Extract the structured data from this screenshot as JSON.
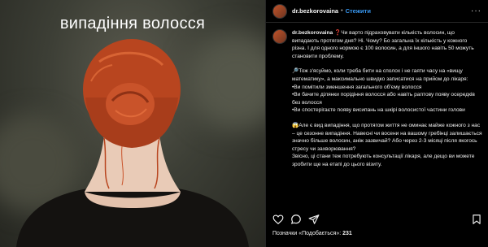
{
  "photo": {
    "caption": "випадіння волосся"
  },
  "header": {
    "username": "dr.bezkorovaina",
    "separator": "•",
    "follow_label": "Стежити",
    "more": "···"
  },
  "post": {
    "username": "dr.bezkorovaina",
    "paragraphs": [
      "❓Чи варто підраховувати кількість волосин, що випадають протягом дня? Ні. Чому? Бо загальна їх кількість у кожного різна. І для одного нормою є 100 волосин, а для іншого навіть 50 можуть становити проблему.",
      "🔎Тож з'ясуймо, коли треба бити на сполох і не гаяти часу на «вищу математику», а максимально швидко записатися на прийом до лікаря:\n•Ви помітили зменшення загального об'єму волосся\n•Ви бачите ділянки порідіння волосся або навіть раптову появу осередків без волосся\n•Ви спостерігаєте появу висипань на шкірі волосистої частини голови",
      "😱Але є вид випадіння, що протягом життя не оминає майже кожного з нас – це сезонне випадіння. Навесні чи восени на вашому гребінці залишається значно більше волосин, аніж зазвичай? Або через 2-3 місяці після якогось стресу чи захворювання?\nЗвісно, ці стани теж потребують консультації лікаря, але дещо ви можете зробити ще на етапі до цього візиту."
    ]
  },
  "footer": {
    "likes_label": "Позначки «Подобається»:",
    "likes_count": "231"
  }
}
